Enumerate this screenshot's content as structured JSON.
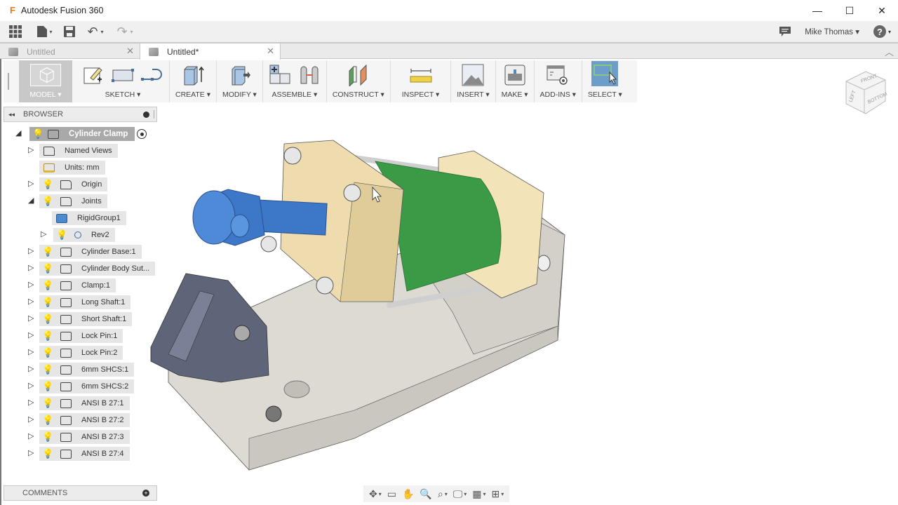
{
  "app": {
    "title": "Autodesk Fusion 360",
    "logo": "F"
  },
  "window_controls": {
    "minimize": "—",
    "maximize": "☐",
    "close": "✕"
  },
  "quick_access": {
    "grid_icon": "▦",
    "file_icon": "▙",
    "save_icon": "💾",
    "undo_icon": "↶",
    "redo_icon": "↷",
    "dropdown": "▾",
    "comments_icon": "💬",
    "user_name": "Mike Thomas ▾",
    "help_label": "?"
  },
  "tabs": [
    {
      "label": "Untitled",
      "active": false,
      "close": "✕"
    },
    {
      "label": "Untitled*",
      "active": true,
      "close": "✕"
    }
  ],
  "tabs_collapse": "︿",
  "toolbar": {
    "workspace": "MODEL ▾",
    "groups": [
      {
        "label": "SKETCH ▾"
      },
      {
        "label": "CREATE ▾"
      },
      {
        "label": "MODIFY ▾"
      },
      {
        "label": "ASSEMBLE ▾"
      },
      {
        "label": "CONSTRUCT ▾"
      },
      {
        "label": "INSPECT ▾"
      },
      {
        "label": "INSERT ▾"
      },
      {
        "label": "MAKE ▾"
      },
      {
        "label": "ADD-INS ▾"
      },
      {
        "label": "SELECT ▾"
      }
    ]
  },
  "viewcube": {
    "faces": [
      "FRONT",
      "LEFT",
      "BOTTOM"
    ]
  },
  "browser": {
    "title": "BROWSER",
    "collapse": "◂◂",
    "root": {
      "name": "Cylinder Clamp",
      "expanded": true
    },
    "items": [
      {
        "name": "Named Views",
        "tri": "▷",
        "bulb": false,
        "icon": "folder"
      },
      {
        "name": "Units: mm",
        "tri": "",
        "bulb": false,
        "icon": "units"
      },
      {
        "name": "Origin",
        "tri": "▷",
        "bulb": "off",
        "icon": "folder"
      },
      {
        "name": "Joints",
        "tri": "◢",
        "bulb": "on",
        "icon": "folder"
      },
      {
        "name": "RigidGroup1",
        "tri": "",
        "bulb": false,
        "icon": "rigid"
      },
      {
        "name": "Rev2",
        "tri": "▷",
        "bulb": "on",
        "icon": "joint"
      },
      {
        "name": "Cylinder Base:1",
        "tri": "▷",
        "bulb": "on",
        "icon": "component"
      },
      {
        "name": "Cylinder Body Sut...",
        "tri": "▷",
        "bulb": "on",
        "icon": "component"
      },
      {
        "name": "Clamp:1",
        "tri": "▷",
        "bulb": "on",
        "icon": "component"
      },
      {
        "name": "Long Shaft:1",
        "tri": "▷",
        "bulb": "on",
        "icon": "component"
      },
      {
        "name": "Short Shaft:1",
        "tri": "▷",
        "bulb": "on",
        "icon": "component"
      },
      {
        "name": "Lock Pin:1",
        "tri": "▷",
        "bulb": "on",
        "icon": "component"
      },
      {
        "name": "Lock Pin:2",
        "tri": "▷",
        "bulb": "on",
        "icon": "component"
      },
      {
        "name": "6mm SHCS:1",
        "tri": "▷",
        "bulb": "on",
        "icon": "component"
      },
      {
        "name": "6mm SHCS:2",
        "tri": "▷",
        "bulb": "on",
        "icon": "component"
      },
      {
        "name": "ANSI B 27:1",
        "tri": "▷",
        "bulb": "on",
        "icon": "component"
      },
      {
        "name": "ANSI B 27:2",
        "tri": "▷",
        "bulb": "on",
        "icon": "component"
      },
      {
        "name": "ANSI B 27:3",
        "tri": "▷",
        "bulb": "on",
        "icon": "component"
      },
      {
        "name": "ANSI B 27:4",
        "tri": "▷",
        "bulb": "on",
        "icon": "component"
      }
    ]
  },
  "comments": {
    "title": "COMMENTS",
    "add": "+"
  },
  "navbar": {
    "orbit": "✥",
    "look": "▭",
    "pan": "✋",
    "zoom": "🔍",
    "fit": "⌕",
    "display": "🖵",
    "grid": "▦",
    "viewports": "⊞",
    "dd": "▾"
  },
  "colors": {
    "blue_part": "#3d78c8",
    "green_body": "#3b9a45",
    "tan_caps": "#efdcae",
    "base": "#dcdad2",
    "clamp": "#5e6578",
    "select_active": "#6f9dc9"
  }
}
